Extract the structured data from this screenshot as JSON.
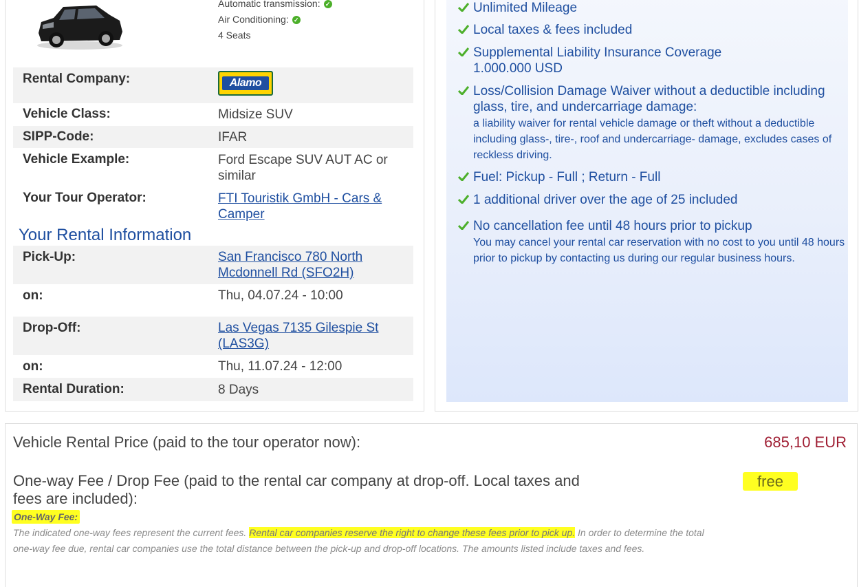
{
  "vehicle": {
    "specs": {
      "transmission": "Automatic transmission:",
      "air_conditioning": "Air Conditioning:",
      "seats": "4 Seats"
    },
    "details": {
      "rental_company_label": "Rental Company:",
      "rental_company_logo": "Alamo",
      "vehicle_class_label": "Vehicle Class:",
      "vehicle_class_value": "Midsize SUV",
      "sipp_label": "SIPP-Code:",
      "sipp_value": "IFAR",
      "example_label": "Vehicle Example:",
      "example_value": "Ford Escape SUV AUT AC or similar",
      "operator_label": "Your Tour Operator:",
      "operator_value": "FTI Touristik GmbH - Cars & Camper"
    }
  },
  "rental_info": {
    "title": "Your Rental Information",
    "pickup_label": "Pick-Up:",
    "pickup_value": "San Francisco 780 North Mcdonnell Rd (SFO2H)",
    "pickup_on_label": "on:",
    "pickup_on_value": "Thu, 04.07.24 - 10:00",
    "dropoff_label": "Drop-Off:",
    "dropoff_value": "Las Vegas 7135 Gilespie St (LAS3G)",
    "dropoff_on_label": "on:",
    "dropoff_on_value": "Thu, 11.07.24 - 12:00",
    "duration_label": "Rental Duration:",
    "duration_value": "8 Days"
  },
  "features": [
    {
      "title": "Unlimited Mileage"
    },
    {
      "title": "Local taxes & fees included"
    },
    {
      "title": "Supplemental Liability Insurance Coverage 1.000.000 USD"
    },
    {
      "title": "Loss/Collision Damage Waiver without a deductible including glass, tire, and undercarriage damage:",
      "desc": "a liability waiver for rental vehicle damage or theft without a deductible including glass-, tire-, roof and undercarriage- damage, excludes cases of reckless driving."
    },
    {
      "title": "Fuel: Pickup - Full ; Return - Full"
    },
    {
      "title": "1 additional driver over the age of 25 included"
    },
    {
      "title": "No cancellation fee until 48 hours prior to pickup",
      "desc": "You may cancel your rental car reservation with no cost to you until 48 hours prior to pickup by contacting us during our regular business hours."
    }
  ],
  "pricing": {
    "rental_price_label": "Vehicle Rental Price (paid to the tour operator now):",
    "rental_price_value": "685,10 EUR",
    "one_way_label": "One-way Fee / Drop Fee (paid to the rental car company at drop-off. Local taxes and fees are included):",
    "one_way_value": "free",
    "one_way_note_title": "One-Way Fee:",
    "note_part1": "The indicated one-way fees represent the current fees.",
    "note_highlight": "Rental car companies reserve the right to change these fees prior to pick up.",
    "note_part2": "In order to determine the total one-way fee due, rental car companies use the total distance between the pick-up and drop-off locations. The amounts listed include taxes and fees."
  },
  "colors": {
    "link": "#1f4fa0",
    "price": "#a01f34",
    "highlight": "#ffff21",
    "check": "#4caf2a"
  }
}
